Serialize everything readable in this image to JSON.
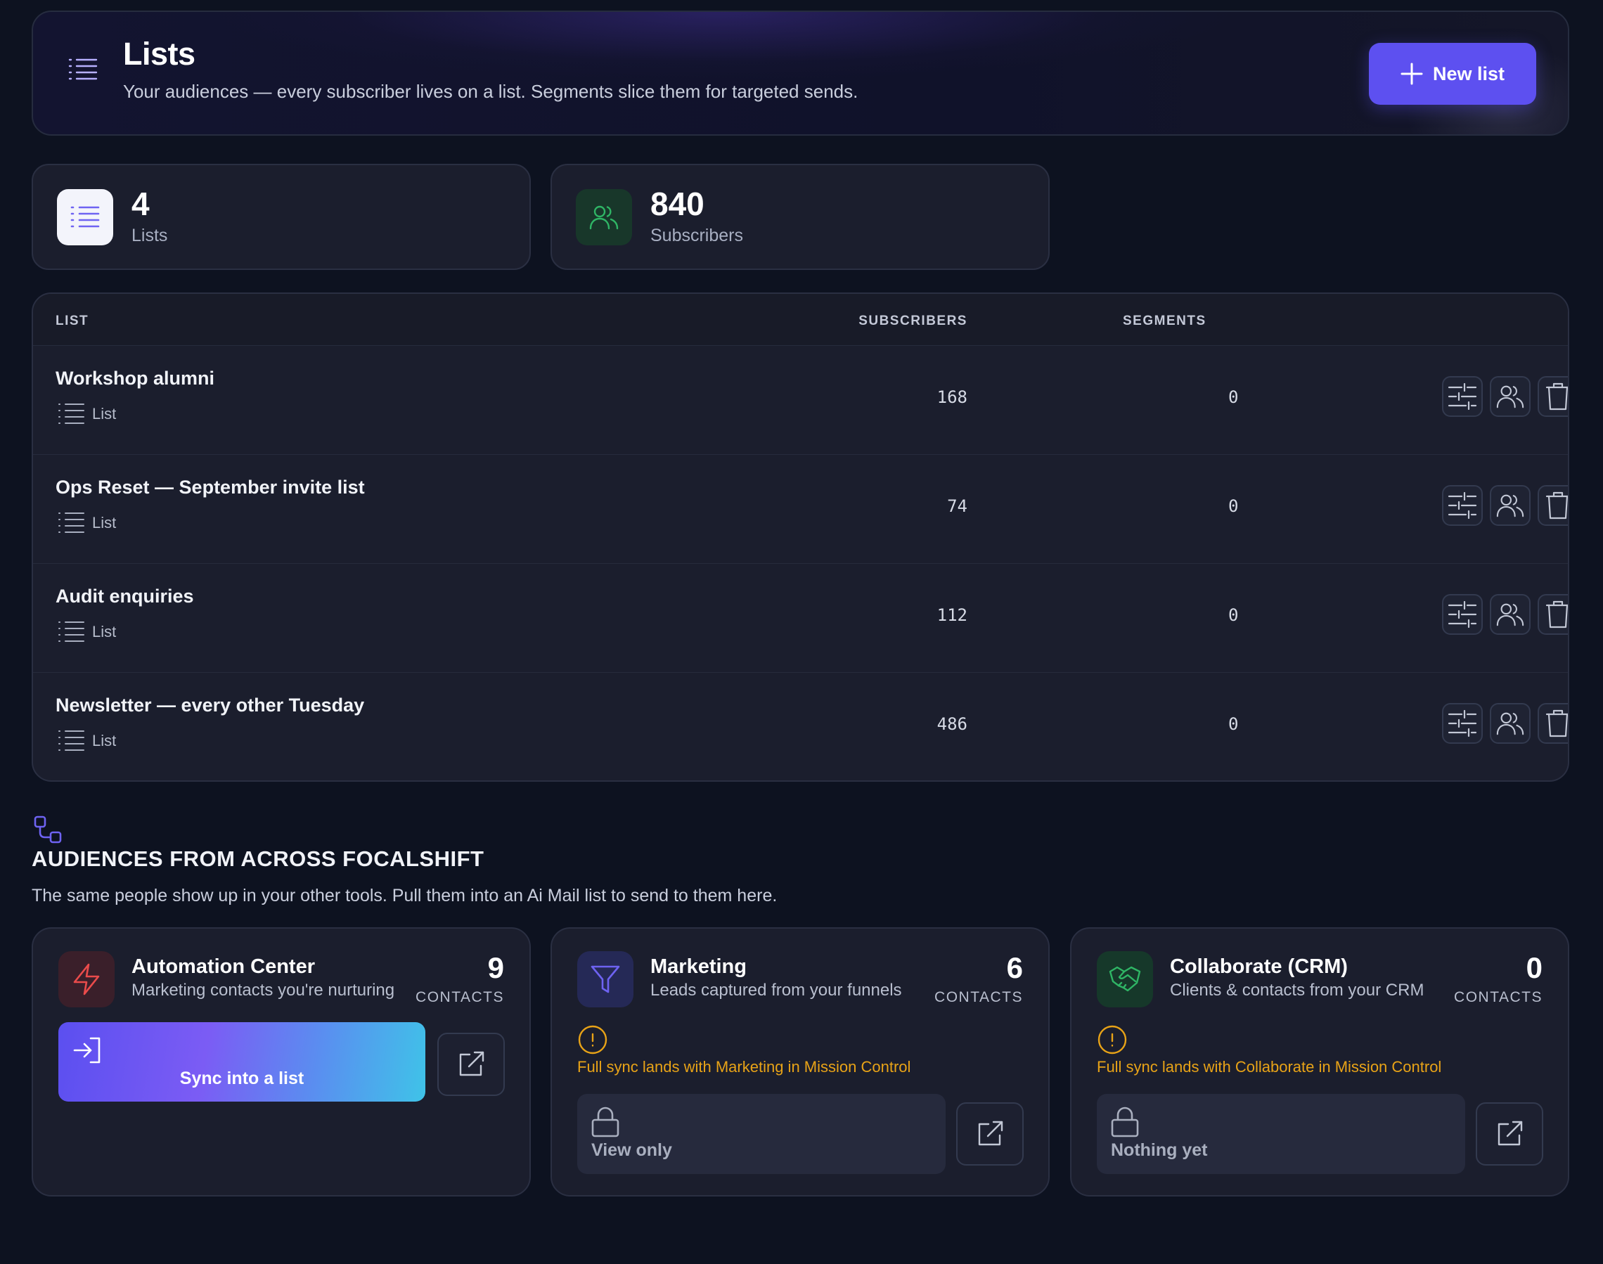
{
  "header": {
    "title": "Lists",
    "subtitle": "Your audiences — every subscriber lives on a list. Segments slice them for targeted sends.",
    "new_list_label": "New list",
    "accent": "#5d50f0"
  },
  "stats": [
    {
      "value": "4",
      "label": "Lists",
      "icon": "list-icon"
    },
    {
      "value": "840",
      "label": "Subscribers",
      "icon": "users-icon"
    }
  ],
  "table": {
    "columns": {
      "list": "LIST",
      "subscribers": "SUBSCRIBERS",
      "segments": "SEGMENTS"
    },
    "rows": [
      {
        "name": "Workshop alumni",
        "type": "List",
        "subscribers": "168",
        "segments": "0"
      },
      {
        "name": "Ops Reset — September invite list",
        "type": "List",
        "subscribers": "74",
        "segments": "0"
      },
      {
        "name": "Audit enquiries",
        "type": "List",
        "subscribers": "112",
        "segments": "0"
      },
      {
        "name": "Newsletter — every other Tuesday",
        "type": "List",
        "subscribers": "486",
        "segments": "0"
      }
    ],
    "row_actions": [
      "sliders-icon",
      "users-icon",
      "trash-icon"
    ]
  },
  "audiences": {
    "title": "AUDIENCES FROM ACROSS FOCALSHIFT",
    "subtitle": "The same people show up in your other tools. Pull them into an Ai Mail list to send to them here.",
    "sources": [
      {
        "name": "Automation Center",
        "description": "Marketing contacts you're nurturing",
        "count": "9",
        "count_label": "CONTACTS",
        "icon": "lightning-icon",
        "action_label": "Sync into a list"
      },
      {
        "name": "Marketing",
        "description": "Leads captured from your funnels",
        "count": "6",
        "count_label": "CONTACTS",
        "icon": "funnel-icon",
        "notice": "Full sync lands with Marketing in Mission Control",
        "locked_label": "View only"
      },
      {
        "name": "Collaborate (CRM)",
        "description": "Clients & contacts from your CRM",
        "count": "0",
        "count_label": "CONTACTS",
        "icon": "handshake-icon",
        "notice": "Full sync lands with Collaborate in Mission Control",
        "locked_label": "Nothing yet"
      }
    ]
  }
}
